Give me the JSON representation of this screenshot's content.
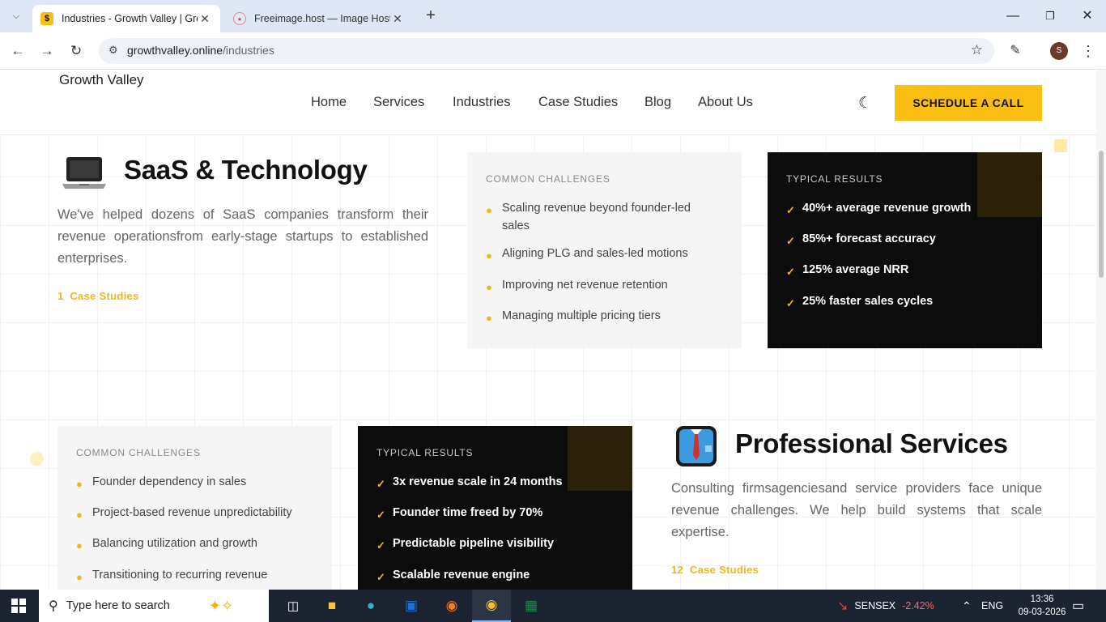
{
  "browser": {
    "tabs": [
      {
        "title": "Industries - Growth Valley | Gro",
        "active": true
      },
      {
        "title": "Freeimage.host — Image Hostin",
        "active": false
      }
    ],
    "url_domain": "growthvalley.online",
    "url_path": "/industries",
    "profile_initial": "S"
  },
  "site": {
    "logo_alt": "Growth Valley",
    "nav": [
      "Home",
      "Services",
      "Industries",
      "Case Studies",
      "Blog",
      "About Us"
    ],
    "cta": "SCHEDULE A CALL",
    "accent_color": "#fbbf14"
  },
  "sections": [
    {
      "icon": "laptop-icon",
      "title": "SaaS & Technology",
      "description": "We've helped dozens of SaaS companies transform their revenue operationsfrom early-stage startups to established enterprises.",
      "case_count": "1",
      "case_label": "Case Studies",
      "challenges_label": "COMMON CHALLENGES",
      "challenges": [
        "Scaling revenue beyond founder-led sales",
        "Aligning PLG and sales-led motions",
        "Improving net revenue retention",
        "Managing multiple pricing tiers"
      ],
      "results_label": "TYPICAL RESULTS",
      "results": [
        "40%+ average revenue growth",
        "85%+ forecast accuracy",
        "125% average NRR",
        "25% faster sales cycles"
      ]
    },
    {
      "icon": "business-shirt-icon",
      "title": "Professional Services",
      "description": "Consulting firmsagenciesand service providers face unique revenue challenges. We help build systems that scale expertise.",
      "case_count": "12",
      "case_label": "Case Studies",
      "challenges_label": "COMMON CHALLENGES",
      "challenges": [
        "Founder dependency in sales",
        "Project-based revenue unpredictability",
        "Balancing utilization and growth",
        "Transitioning to recurring revenue"
      ],
      "results_label": "TYPICAL RESULTS",
      "results": [
        "3x revenue scale in 24 months",
        "Founder time freed by 70%",
        "Predictable pipeline visibility",
        "Scalable revenue engine"
      ]
    }
  ],
  "taskbar": {
    "search_placeholder": "Type here to search",
    "stock_name": "SENSEX",
    "stock_change": "-2.42%",
    "language": "ENG",
    "time": "13:36",
    "date": "09-03-2026"
  }
}
